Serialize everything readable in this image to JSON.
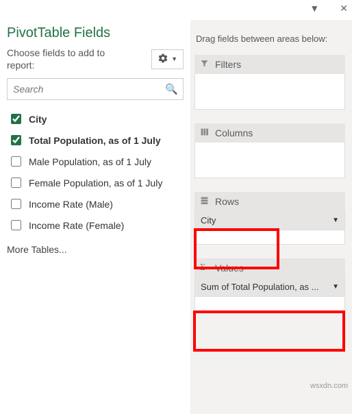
{
  "header": {
    "title": "PivotTable Fields",
    "subtitle": "Choose fields to add to report:"
  },
  "search": {
    "placeholder": "Search"
  },
  "fields": [
    {
      "label": "City",
      "checked": true
    },
    {
      "label": "Total Population, as of 1 July",
      "checked": true
    },
    {
      "label": "Male Population, as of 1 July",
      "checked": false
    },
    {
      "label": "Female Population, as of 1 July",
      "checked": false
    },
    {
      "label": "Income Rate (Male)",
      "checked": false
    },
    {
      "label": "Income Rate (Female)",
      "checked": false
    }
  ],
  "more_tables": "More Tables...",
  "drag_label": "Drag fields between areas below:",
  "areas": {
    "filters": {
      "title": "Filters",
      "items": []
    },
    "columns": {
      "title": "Columns",
      "items": []
    },
    "rows": {
      "title": "Rows",
      "items": [
        "City"
      ]
    },
    "values": {
      "title": "Values",
      "items": [
        "Sum of Total Population, as ..."
      ]
    }
  },
  "watermark": "wsxdn.com"
}
